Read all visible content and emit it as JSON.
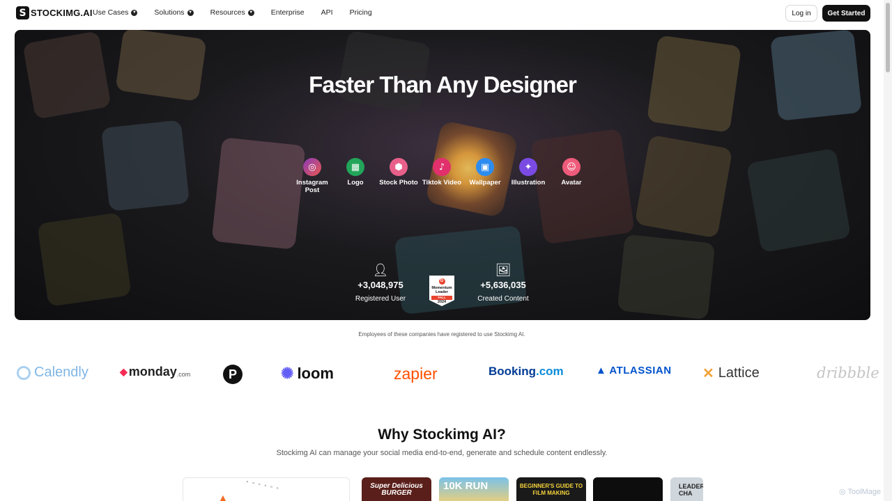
{
  "nav": {
    "logo_mark": "S",
    "brand": "STOCKIMG.AI",
    "links": [
      {
        "label": "Use Cases",
        "dropdown": true
      },
      {
        "label": "Solutions",
        "dropdown": true
      },
      {
        "label": "Resources",
        "dropdown": true
      },
      {
        "label": "Enterprise",
        "dropdown": false
      },
      {
        "label": "API",
        "dropdown": false
      },
      {
        "label": "Pricing",
        "dropdown": false
      }
    ],
    "login": "Log in",
    "cta": "Get Started"
  },
  "hero": {
    "title": "Faster Than Any Designer",
    "categories": [
      {
        "label": "Instagram Post",
        "icon": "instagram-icon",
        "color": "#c13584"
      },
      {
        "label": "Logo",
        "icon": "grid-icon",
        "color": "#22a55a"
      },
      {
        "label": "Stock Photo",
        "icon": "cube-icon",
        "color": "#e8608a"
      },
      {
        "label": "Tiktok Video",
        "icon": "tiktok-icon",
        "color": "#e1306c"
      },
      {
        "label": "Wallpaper",
        "icon": "image-icon",
        "color": "#2d8cf0"
      },
      {
        "label": "Illustration",
        "icon": "sparkle-icon",
        "color": "#7b4ae2"
      },
      {
        "label": "Avatar",
        "icon": "user-icon",
        "color": "#ef5b7b"
      }
    ],
    "stats": {
      "users_value": "+3,048,975",
      "users_label": "Registered User",
      "content_value": "+5,636,035",
      "content_label": "Created Content"
    },
    "badge": {
      "line1": "Momentum",
      "line2": "Leader",
      "season": "FALL",
      "year": "2024"
    }
  },
  "companies": {
    "caption": "Employees of these companies have registered to use Stockimg AI.",
    "logos": [
      "Calendly",
      "monday",
      ".com",
      "loom",
      "zapier",
      "Booking",
      ".com",
      "ATLASSIAN",
      "Lattice",
      "dribbble"
    ]
  },
  "why": {
    "title": "Why Stockimg AI?",
    "subtitle": "Stockimg AI can manage your social media end-to-end, generate and schedule content endlessly."
  },
  "thumbnails": [
    "Super Delicious BURGER",
    "10K RUN",
    "BEGINNER'S GUIDE TO FILM MAKING",
    "LEADER CHA"
  ],
  "watermark": "ToolMage"
}
